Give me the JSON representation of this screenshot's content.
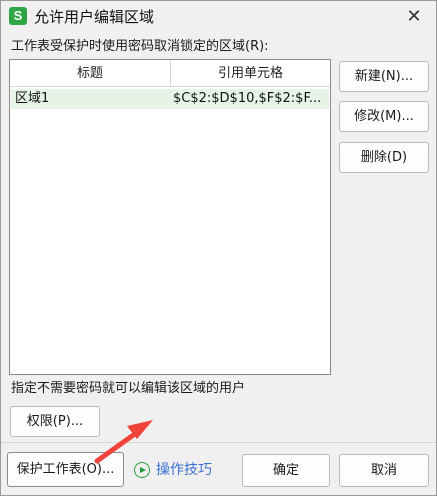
{
  "window": {
    "app_icon_letter": "S",
    "title": "允许用户编辑区域",
    "close_symbol": "✕"
  },
  "ranges_label": "工作表受保护时使用密码取消锁定的区域(R):",
  "list": {
    "columns": [
      "标题",
      "引用单元格"
    ],
    "rows": [
      {
        "title": "区域1",
        "ref": "$C$2:$D$10,$F$2:$F..."
      }
    ]
  },
  "side_buttons": {
    "new": "新建(N)...",
    "modify": "修改(M)...",
    "delete": "删除(D)"
  },
  "users_label": "指定不需要密码就可以编辑该区域的用户",
  "permissions_button": "权限(P)...",
  "bottom": {
    "protect_sheet_button": "保护工作表(O)...",
    "tips_link": "操作技巧",
    "ok_button": "确定",
    "cancel_button": "取消"
  },
  "colors": {
    "accent_green": "#2fa646",
    "arrow_red": "#f0443a",
    "selected_row": "#e6f4e7",
    "link_blue": "#3b6fd3"
  }
}
